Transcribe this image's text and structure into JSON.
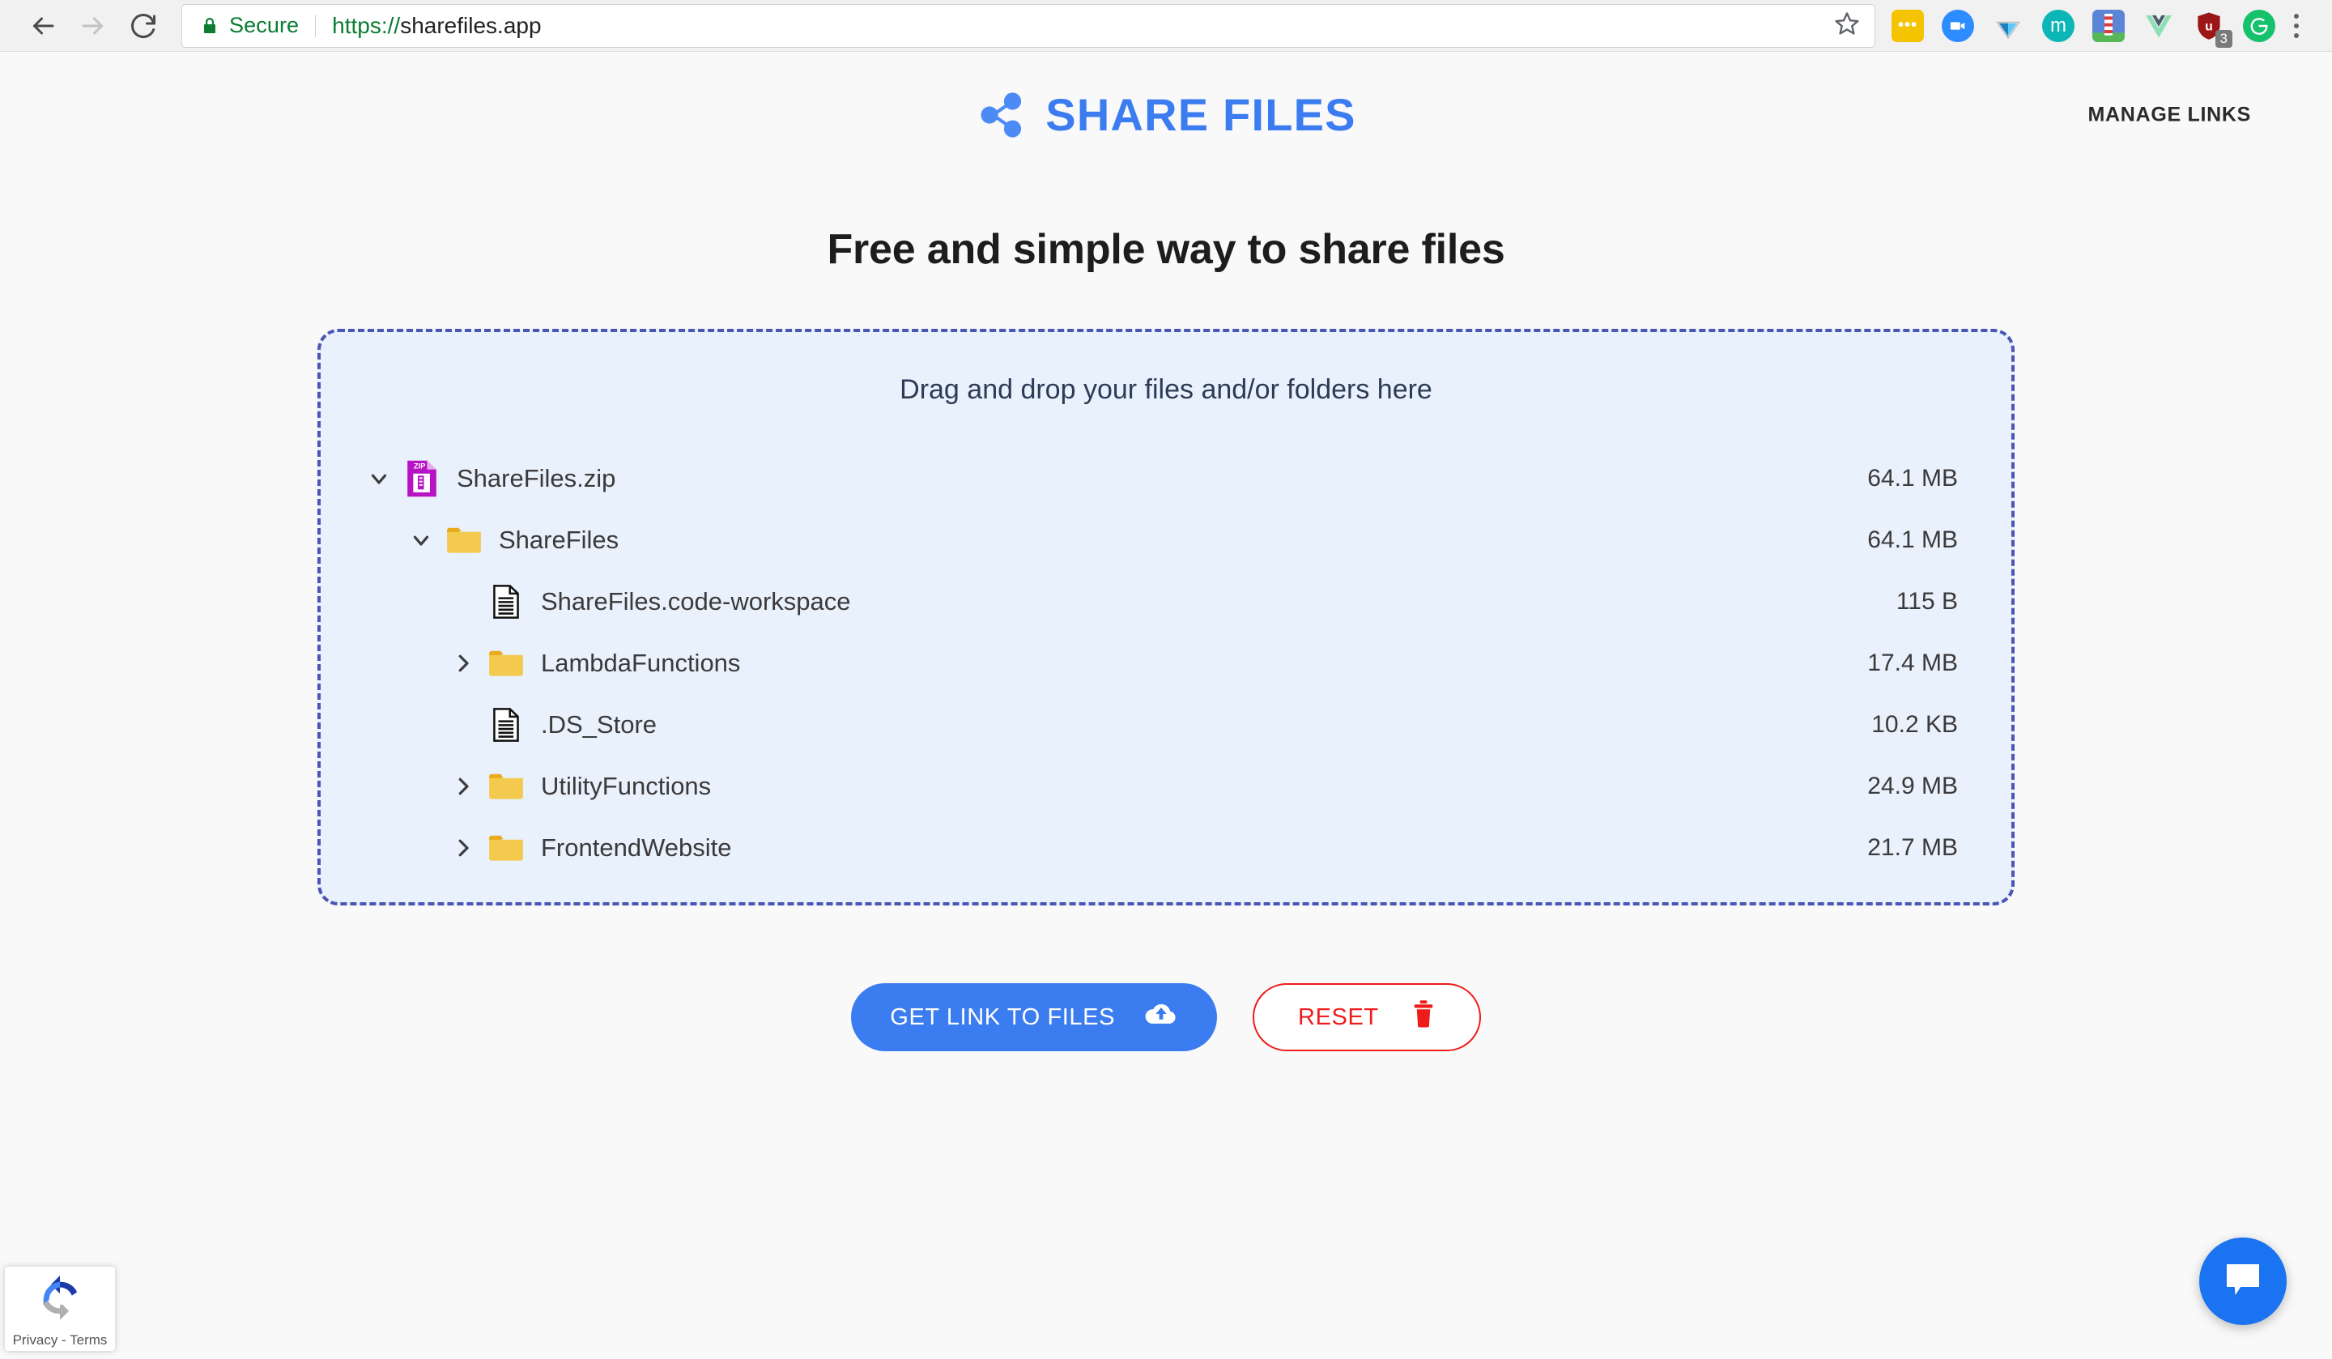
{
  "browser": {
    "back_icon": "back-arrow-icon",
    "forward_icon": "forward-arrow-icon",
    "reload_icon": "reload-icon",
    "security_label": "Secure",
    "url_scheme": "https://",
    "url_host": "sharefiles.app",
    "url_full": "https://sharefiles.app",
    "bookmark_icon": "star-icon",
    "menu_icon": "kebab-menu-icon",
    "extensions": [
      {
        "name": "dots-extension-icon",
        "color": "#f5c400",
        "glyph": "•••",
        "badge": ""
      },
      {
        "name": "zoom-extension-icon",
        "color": "#2d8cff",
        "glyph": "▶",
        "badge": ""
      },
      {
        "name": "diamond-extension-icon",
        "color": "#ffffff",
        "glyph": "◆",
        "badge": ""
      },
      {
        "name": "mendeley-extension-icon",
        "color": "#0cb6b6",
        "glyph": "m",
        "badge": ""
      },
      {
        "name": "lighthouse-extension-icon",
        "color": "#4a7fd4",
        "glyph": "▐",
        "badge": ""
      },
      {
        "name": "vue-devtools-extension-icon",
        "color": "#ffffff",
        "glyph": "V",
        "badge": ""
      },
      {
        "name": "ublock-origin-extension-icon",
        "color": "#9b1616",
        "glyph": "u",
        "badge": "3"
      },
      {
        "name": "grammarly-extension-icon",
        "color": "#15c26b",
        "glyph": "G",
        "badge": ""
      }
    ]
  },
  "site": {
    "logo_icon": "share-nodes-icon",
    "logo_text": "SHARE FILES",
    "manage_links_label": "MANAGE LINKS",
    "brand_color": "#3b7cf0"
  },
  "main": {
    "headline": "Free and simple way to share files",
    "dropzone_prompt": "Drag and drop your files and/or folders here",
    "dropzone_border_color": "#4a55b5",
    "dropzone_fill_color": "#e9f1fd"
  },
  "file_tree": [
    {
      "name": "ShareFiles.zip",
      "size": "64.1 MB",
      "depth": 0,
      "icon": "zip-file-icon",
      "twisty": "expanded"
    },
    {
      "name": "ShareFiles",
      "size": "64.1 MB",
      "depth": 1,
      "icon": "folder-icon",
      "twisty": "expanded"
    },
    {
      "name": "ShareFiles.code-workspace",
      "size": "115 B",
      "depth": 2,
      "icon": "document-icon",
      "twisty": "none"
    },
    {
      "name": "LambdaFunctions",
      "size": "17.4 MB",
      "depth": 2,
      "icon": "folder-icon",
      "twisty": "collapsed"
    },
    {
      "name": ".DS_Store",
      "size": "10.2 KB",
      "depth": 2,
      "icon": "document-icon",
      "twisty": "none"
    },
    {
      "name": "UtilityFunctions",
      "size": "24.9 MB",
      "depth": 2,
      "icon": "folder-icon",
      "twisty": "collapsed"
    },
    {
      "name": "FrontendWebsite",
      "size": "21.7 MB",
      "depth": 2,
      "icon": "folder-icon",
      "twisty": "collapsed"
    }
  ],
  "actions": {
    "primary_label": "GET LINK TO FILES",
    "primary_icon": "cloud-upload-icon",
    "primary_color": "#3b7cf0",
    "reset_label": "RESET",
    "reset_icon": "trash-icon",
    "reset_color": "#ef1c1c"
  },
  "recaptcha": {
    "icon": "recaptcha-logo-icon",
    "label": "Privacy - Terms"
  },
  "chat": {
    "icon": "chat-bubble-icon",
    "color": "#1a73f0"
  }
}
